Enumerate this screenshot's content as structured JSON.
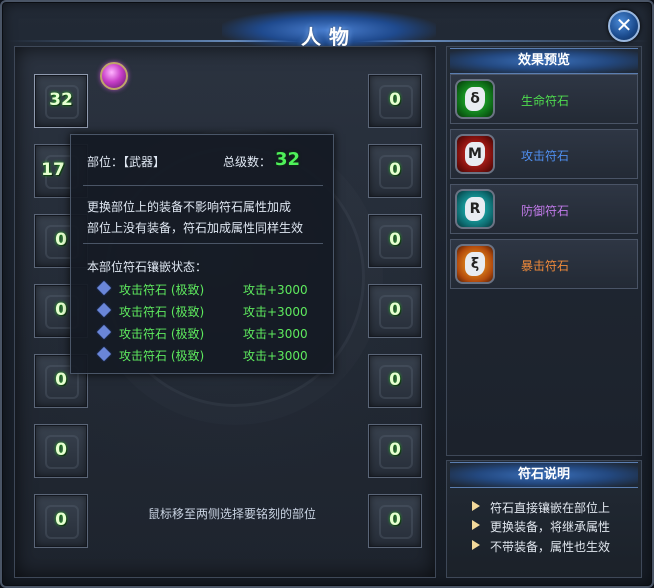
{
  "window": {
    "title": "人物",
    "close_symbol": "✕"
  },
  "left_slots": [
    {
      "count": "32"
    },
    {
      "count": "17"
    },
    {
      "count": "0"
    },
    {
      "count": "0"
    },
    {
      "count": "0"
    },
    {
      "count": "0"
    },
    {
      "count": "0"
    }
  ],
  "right_slots": [
    {
      "count": "0"
    },
    {
      "count": "0"
    },
    {
      "count": "0"
    },
    {
      "count": "0"
    },
    {
      "count": "0"
    },
    {
      "count": "0"
    },
    {
      "count": "0"
    }
  ],
  "tooltip": {
    "part_label": "部位：【武器】",
    "total_level_label": "总级数：",
    "total_level_value": "32",
    "note_line1": "更换部位上的装备不影响符石属性加成",
    "note_line2": "部位上没有装备，符石加成属性同样生效",
    "status_title": "本部位符石镶嵌状态：",
    "runes": [
      {
        "name": "攻击符石 (极致)",
        "bonus": "攻击+3000"
      },
      {
        "name": "攻击符石 (极致)",
        "bonus": "攻击+3000"
      },
      {
        "name": "攻击符石 (极致)",
        "bonus": "攻击+3000"
      },
      {
        "name": "攻击符石 (极致)",
        "bonus": "攻击+3000"
      }
    ]
  },
  "hint": "鼠标移至两侧选择要铭刻的部位",
  "preview": {
    "title": "效果预览",
    "items": [
      {
        "label": "生命符石",
        "color": "#4fdc4f",
        "glyph": "δ"
      },
      {
        "label": "攻击符石",
        "color": "#4f8ff0",
        "glyph": "M"
      },
      {
        "label": "防御符石",
        "color": "#c07ae8",
        "glyph": "R"
      },
      {
        "label": "暴击符石",
        "color": "#f08a3a",
        "glyph": "ξ"
      }
    ]
  },
  "description": {
    "title": "符石说明",
    "items": [
      "符石直接镶嵌在部位上",
      "更换装备，将继承属性",
      "不带装备，属性也生效"
    ]
  }
}
